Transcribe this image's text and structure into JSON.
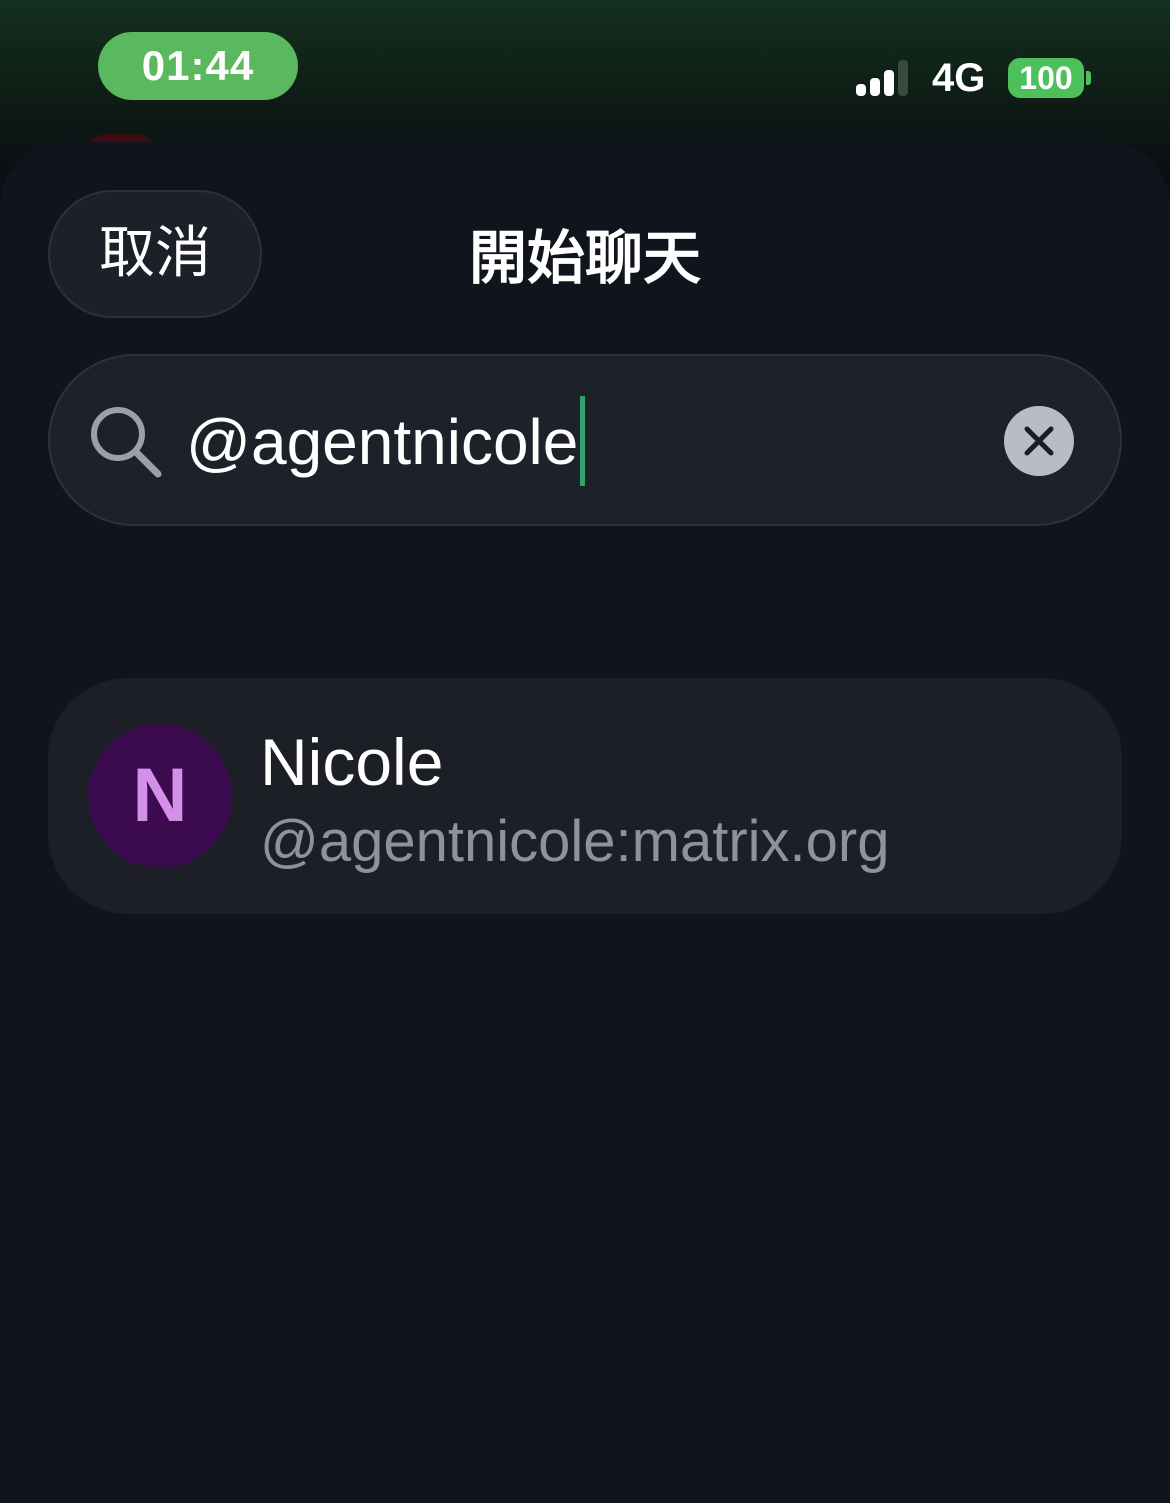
{
  "status_bar": {
    "time": "01:44",
    "network": "4G",
    "battery": "100",
    "signal_icon": "cellular-signal-icon"
  },
  "header": {
    "cancel_label": "取消",
    "title": "開始聊天"
  },
  "search": {
    "value": "@agentnicole",
    "icon": "search-icon",
    "clear_icon": "clear-icon"
  },
  "results": [
    {
      "avatar_letter": "N",
      "display_name": "Nicole",
      "user_id": "@agentnicole:matrix.org"
    }
  ],
  "colors": {
    "time_pill": "#5cb85f",
    "battery": "#4cc05a",
    "caret": "#2fa36b",
    "avatar_bg": "#3b0a4f",
    "avatar_fg": "#d48fe8",
    "sheet_bg": "#10141c"
  }
}
